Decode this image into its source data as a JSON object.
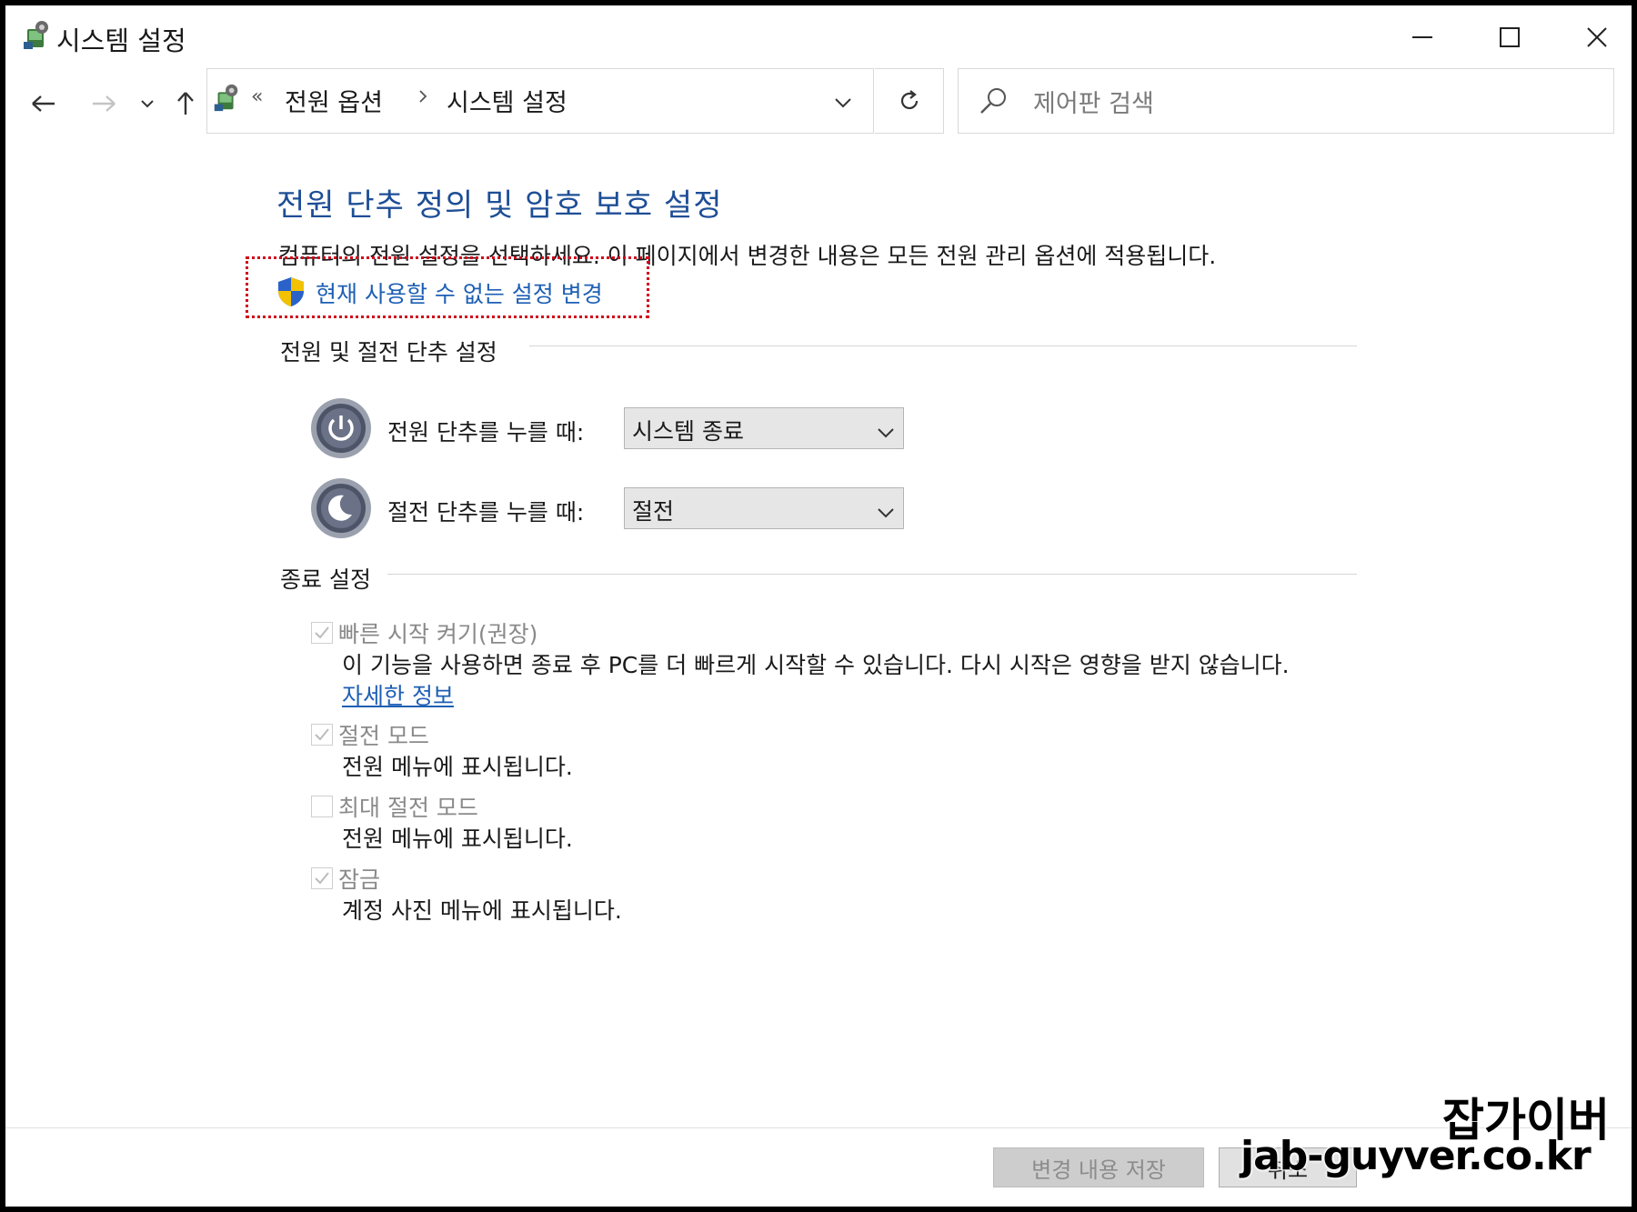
{
  "window": {
    "title": "시스템 설정"
  },
  "toolbar": {
    "breadcrumb_overflow": "«",
    "breadcrumb": [
      "전원 옵션",
      "시스템 설정"
    ],
    "search_placeholder": "제어판 검색"
  },
  "main": {
    "heading": "전원 단추 정의 및 암호 보호 설정",
    "description": "컴퓨터의 전원 설정을 선택하세요. 이 페이지에서 변경한 내용은 모든 전원 관리 옵션에 적용됩니다.",
    "admin_link": "현재 사용할 수 없는 설정 변경",
    "power_section": {
      "title": "전원 및 절전 단추 설정",
      "power_button_label": "전원 단추를 누를 때:",
      "power_button_value": "시스템 종료",
      "sleep_button_label": "절전 단추를 누를 때:",
      "sleep_button_value": "절전"
    },
    "shutdown_section": {
      "title": "종료 설정",
      "options": [
        {
          "label": "빠른 시작 켜기(권장)",
          "checked": true,
          "description": "이 기능을 사용하면 종료 후 PC를 더 빠르게 시작할 수 있습니다. 다시 시작은 영향을 받지 않습니다.",
          "link": "자세한 정보"
        },
        {
          "label": "절전 모드",
          "checked": true,
          "description": "전원 메뉴에 표시됩니다."
        },
        {
          "label": "최대 절전 모드",
          "checked": false,
          "description": "전원 메뉴에 표시됩니다."
        },
        {
          "label": "잠금",
          "checked": true,
          "description": "계정 사진 메뉴에 표시됩니다."
        }
      ]
    }
  },
  "footer": {
    "save_label": "변경 내용 저장",
    "cancel_label": "취소"
  },
  "watermark": {
    "line1": "잡가이버",
    "line2": "jab-guyver.co.kr"
  },
  "colors": {
    "heading": "#1e4e96",
    "link": "#1e5fb4",
    "highlight_box": "#d0021b"
  }
}
